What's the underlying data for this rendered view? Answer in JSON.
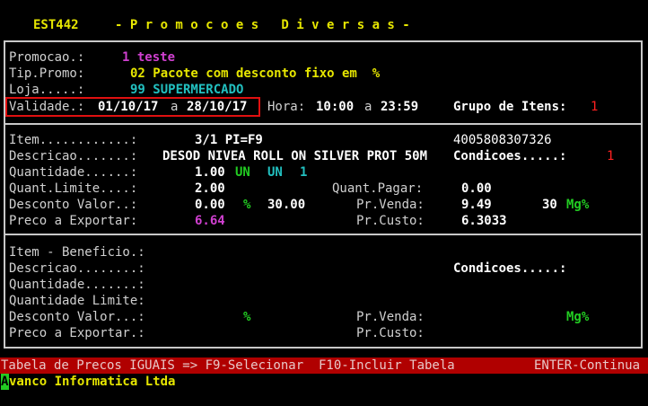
{
  "header": {
    "code": "EST442",
    "title": "- P r o m o c o e s   D i v e r s a s -"
  },
  "promo": {
    "promocao_label": "Promocao.:",
    "promocao_value": "1 teste",
    "tipo_label": "Tip.Promo:",
    "tipo_value": "02 Pacote com desconto fixo em  %",
    "loja_label": "Loja.....:",
    "loja_value": "99 SUPERMERCADO",
    "validade_label": "Validade.:",
    "validade_start": "01/10/17",
    "validade_sep": "a",
    "validade_end": "28/10/17",
    "hora_label": "Hora:",
    "hora_start": "10:00",
    "hora_sep": "a",
    "hora_end": "23:59",
    "grupo_label": "Grupo de Itens:",
    "grupo_value": "1"
  },
  "item": {
    "item_label": "Item............:",
    "item_value": "3/1 PI=F9",
    "barcode": "4005808307326",
    "descricao_label": "Descricao.......:",
    "descricao_value": "DESOD NIVEA ROLL ON SILVER PROT 50M",
    "condicoes_label": "Condicoes.....:",
    "condicoes_value": "1",
    "quantidade_label": "Quantidade......:",
    "quantidade_value": "1.00",
    "quantidade_un1": "UN",
    "quantidade_un2": "UN",
    "quantidade_extra": "1",
    "quant_limite_label": "Quant.Limite....:",
    "quant_limite_value": "2.00",
    "quant_pagar_label": "Quant.Pagar:",
    "quant_pagar_value": "0.00",
    "desconto_label": "Desconto Valor..:",
    "desconto_value": "0.00",
    "desconto_pct_sign": "%",
    "desconto_pct": "30.00",
    "pr_venda_label": "Pr.Venda:",
    "pr_venda_value": "9.49",
    "pr_venda_qty": "30",
    "pr_venda_unit": "Mg%",
    "preco_exportar_label": "Preco a Exportar:",
    "preco_exportar_value": "6.64",
    "pr_custo_label": "Pr.Custo:",
    "pr_custo_value": "6.3033"
  },
  "beneficio": {
    "item_label": "Item - Beneficio.:",
    "descricao_label": "Descricao........:",
    "condicoes_label": "Condicoes.....:",
    "quantidade_label": "Quantidade.......:",
    "quant_limite_label": "Quantidade Limite:",
    "desconto_label": "Desconto Valor...:",
    "desconto_pct_sign": "%",
    "pr_venda_label": "Pr.Venda:",
    "pr_venda_unit": "Mg%",
    "preco_exportar_label": "Preco a Exportar.:",
    "pr_custo_label": "Pr.Custo:"
  },
  "statusbar": {
    "left": "Tabela de Precos IGUAIS => F9-Selecionar  F10-Incluir Tabela",
    "right": "ENTER-Continua"
  },
  "footer": {
    "company_first": "A",
    "company_rest": "vanco Informatica Ltda"
  },
  "colors": {
    "background": "#000000",
    "statusbar": "#b00000",
    "highlight_border": "#e01010"
  }
}
